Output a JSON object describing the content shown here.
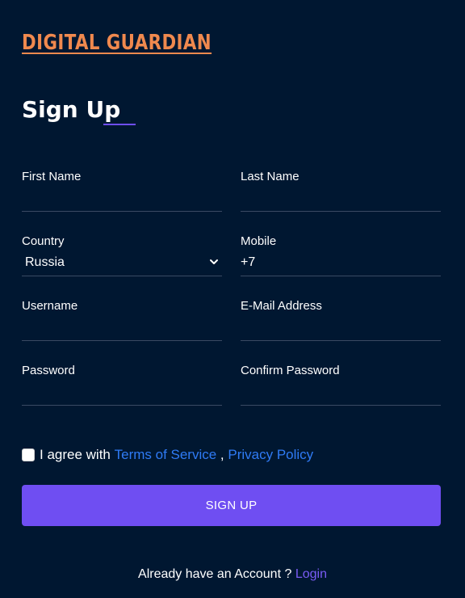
{
  "brand": {
    "logo_text": "DIGITAL GUARDIAN",
    "logo_color": "#f0894e"
  },
  "form": {
    "title": "Sign Up",
    "fields": {
      "first_name": {
        "label": "First Name",
        "value": ""
      },
      "last_name": {
        "label": "Last Name",
        "value": ""
      },
      "country": {
        "label": "Country",
        "value": "Russia"
      },
      "mobile": {
        "label": "Mobile",
        "value": "+7"
      },
      "username": {
        "label": "Username",
        "value": ""
      },
      "email": {
        "label": "E-Mail Address",
        "value": ""
      },
      "password": {
        "label": "Password",
        "value": ""
      },
      "confirm_password": {
        "label": "Confirm Password",
        "value": ""
      }
    },
    "agree": {
      "checked": false,
      "text": "I agree with ",
      "terms_link": "Terms of Service",
      "separator": " , ",
      "privacy_link": "Privacy Policy"
    },
    "submit_label": "SIGN UP"
  },
  "footer": {
    "text": "Already have an Account ? ",
    "login_link": "Login"
  },
  "colors": {
    "background": "#001731",
    "accent": "#6f4ef2",
    "link": "#2f7bf5"
  }
}
